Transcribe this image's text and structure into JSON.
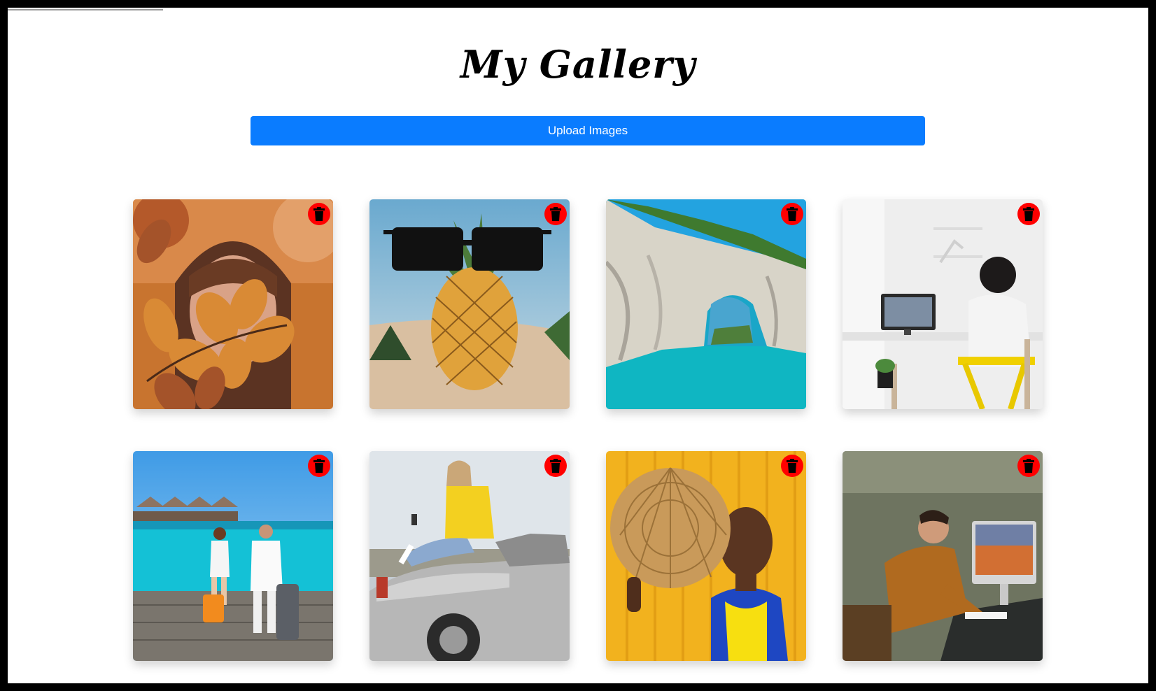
{
  "page": {
    "title": "My Gallery",
    "upload_label": "Upload Images"
  },
  "colors": {
    "accent": "#0a7cff",
    "delete": "#ff0000"
  },
  "gallery": {
    "images": [
      {
        "subject": "woman-autumn-leaves",
        "action_icon": "trash-icon"
      },
      {
        "subject": "pineapple-sunglasses",
        "action_icon": "trash-icon"
      },
      {
        "subject": "sea-arch-cliff",
        "action_icon": "trash-icon"
      },
      {
        "subject": "person-at-computer-desk",
        "action_icon": "trash-icon"
      },
      {
        "subject": "couple-on-pier-with-luggage",
        "action_icon": "trash-icon"
      },
      {
        "subject": "woman-on-convertible-car",
        "action_icon": "trash-icon"
      },
      {
        "subject": "woman-with-straw-hat",
        "action_icon": "trash-icon"
      },
      {
        "subject": "man-writing-at-imac",
        "action_icon": "trash-icon"
      }
    ]
  }
}
